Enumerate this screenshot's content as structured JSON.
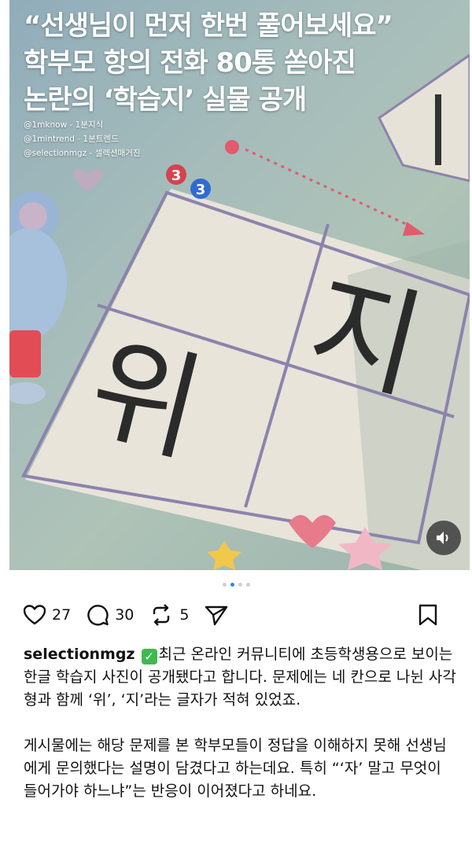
{
  "post": {
    "headline": [
      "“선생님이 먼저 한번 풀어보세요”",
      "학부모 항의 전화 80통 쏟아진",
      "논란의 ‘학습지’ 실물 공개"
    ],
    "credits": [
      "@1mknow - 1분지식",
      "@1mintrend - 1분트렌드",
      "@selectionmgz - 셀렉션매거진"
    ],
    "worksheet": {
      "circle_labels": [
        "3",
        "3"
      ],
      "char_left": "위",
      "char_right": "지"
    },
    "carousel": {
      "total": 4,
      "active_index": 1
    },
    "actions": {
      "likes": "27",
      "comments": "30",
      "reposts": "5"
    },
    "caption": {
      "username": "selectionmgz",
      "check_emoji": "✓",
      "para1": "최근 온라인 커뮤니티에 초등학생용으로 보이는 한글 학습지 사진이 공개됐다고 합니다. 문제에는 네 칸으로 나뉜 사각형과 함께 ‘위’, ‘지’라는 글자가 적혀 있었죠.",
      "para2": "게시물에는 해당 문제를 본 학부모들이 정답을 이해하지 못해 선생님에게 문의했다는 설명이 담겼다고 하는데요. 특히 “‘자’ 말고 무엇이 들어가야 하느냐”는 반응이 이어졌다고 하네요."
    }
  },
  "colors": {
    "accent": "#2f80ff",
    "check_green": "#3fb950",
    "worksheet_paper": "#e9e6dc",
    "grid_line": "#8f86b0"
  }
}
